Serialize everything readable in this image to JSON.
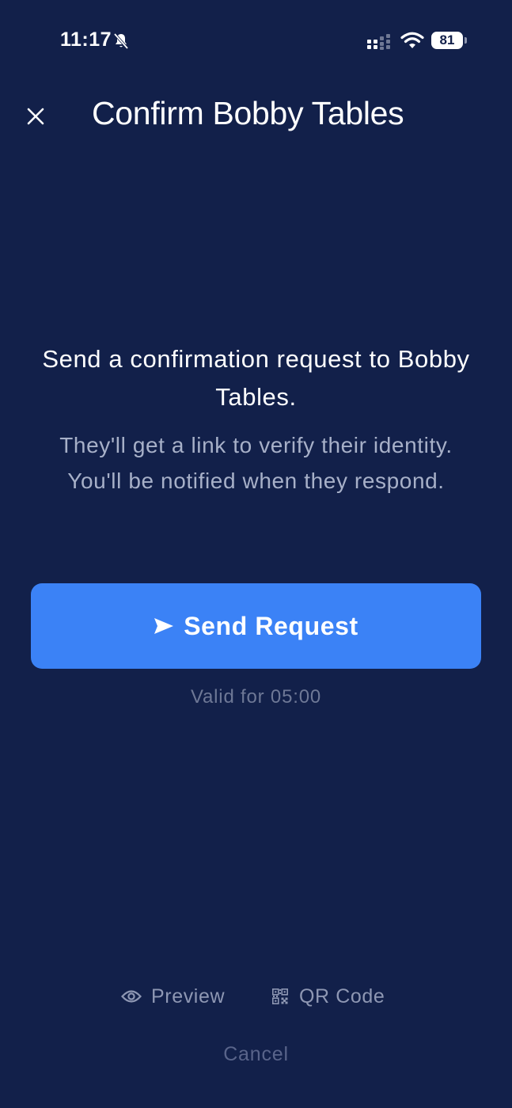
{
  "status_bar": {
    "time": "11:17",
    "battery_level": "81",
    "icons": [
      "bell-off-icon",
      "signal-icon",
      "wifi-icon",
      "battery-icon"
    ]
  },
  "header": {
    "title": "Confirm Bobby Tables",
    "close_icon": "close-icon"
  },
  "message": {
    "primary": "Send a confirmation request to Bobby Tables.",
    "secondary_line1": "They'll get a link to verify their identity.",
    "secondary_line2": "You'll be notified when they respond."
  },
  "send_button": {
    "label": "Send Request",
    "icon": "send-icon"
  },
  "validity": "Valid for 05:00",
  "actions": {
    "preview_label": "Preview",
    "preview_icon": "eye-icon",
    "qr_label": "QR Code",
    "qr_icon": "qr-code-icon",
    "cancel_label": "Cancel"
  },
  "colors": {
    "background": "#12204a",
    "accent": "#3b82f6",
    "text_primary": "#ffffff",
    "text_secondary": "#a7b0c8",
    "text_muted": "#6e7896"
  }
}
